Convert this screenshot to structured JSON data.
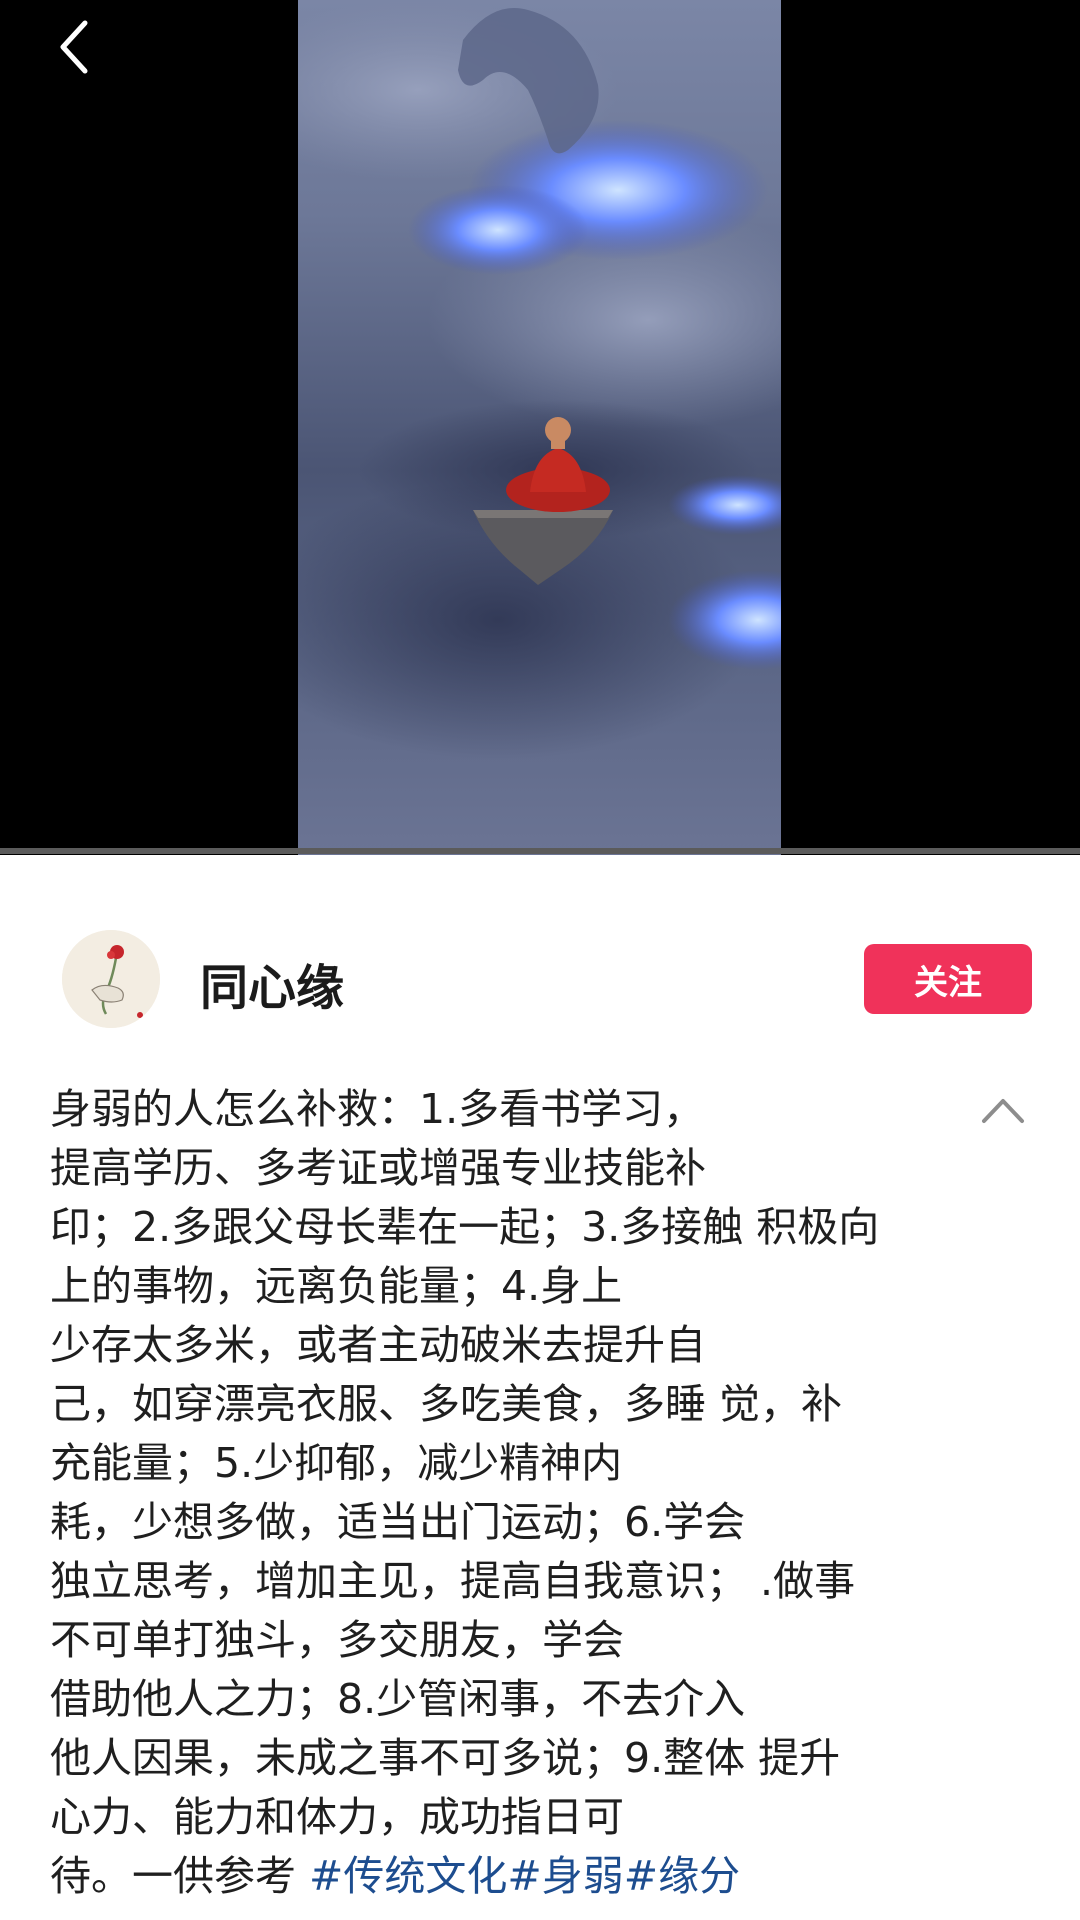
{
  "author": {
    "name": "同心缘",
    "follow_label": "关注"
  },
  "description": {
    "lines": [
      "身弱的人怎么补救：1.多看书学习，",
      "提高学历、多考证或增强专业技能补",
      "印；2.多跟父母长辈在一起；3.多接触 积极向",
      "上的事物，远离负能量；4.身上",
      "少存太多米，或者主动破米去提升自",
      "己，如穿漂亮衣服、多吃美食，多睡 觉，补",
      "充能量；5.少抑郁，减少精神内",
      "耗，少想多做，适当出门运动；6.学会",
      "独立思考，增加主见，提高自我意识；  .做事",
      "不可单打独斗，多交朋友，学会",
      "借助他人之力；8.少管闲事，不去介入",
      "他人因果，未成之事不可多说；9.整体 提升",
      "心力、能力和体力，成功指日可"
    ],
    "last_line_text": "待。一供参考 ",
    "hashtags": "#传统文化#身弱#缘分"
  },
  "icons": {
    "back": "chevron-left-icon",
    "collapse": "chevron-up-icon"
  },
  "colors": {
    "follow_button": "#f0325a",
    "hashtag": "#1d4d8f"
  }
}
